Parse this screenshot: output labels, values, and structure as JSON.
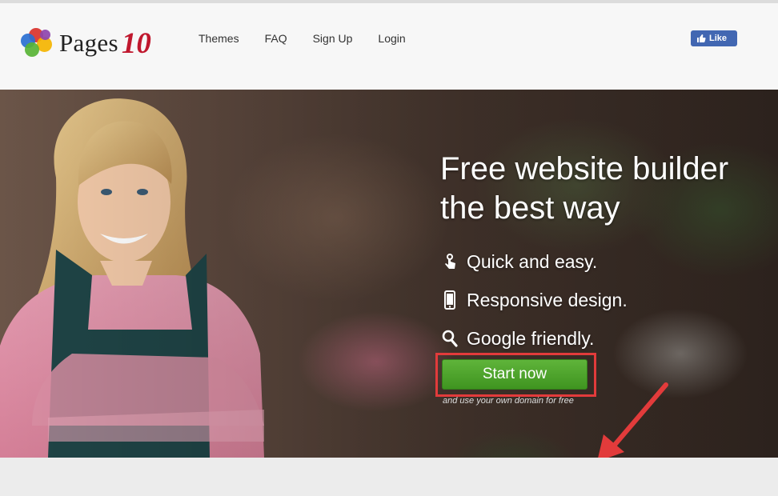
{
  "header": {
    "logo": {
      "word": "Pages",
      "number": "10"
    },
    "nav": [
      {
        "label": "Themes"
      },
      {
        "label": "FAQ"
      },
      {
        "label": "Sign Up"
      },
      {
        "label": "Login"
      }
    ],
    "facebook_like": {
      "label": "Like",
      "color": "#4267b2"
    }
  },
  "hero": {
    "headline_line1": "Free website builder",
    "headline_line2": "the best way",
    "features": [
      {
        "icon": "touch-icon",
        "label": "Quick and easy."
      },
      {
        "icon": "smartphone-icon",
        "label": "Responsive design."
      },
      {
        "icon": "search-icon",
        "label": "Google friendly."
      }
    ],
    "cta": {
      "label": "Start now",
      "color": "#4ca32b",
      "highlight_color": "#e23b3b"
    },
    "cta_note": "and use your own domain for free"
  }
}
